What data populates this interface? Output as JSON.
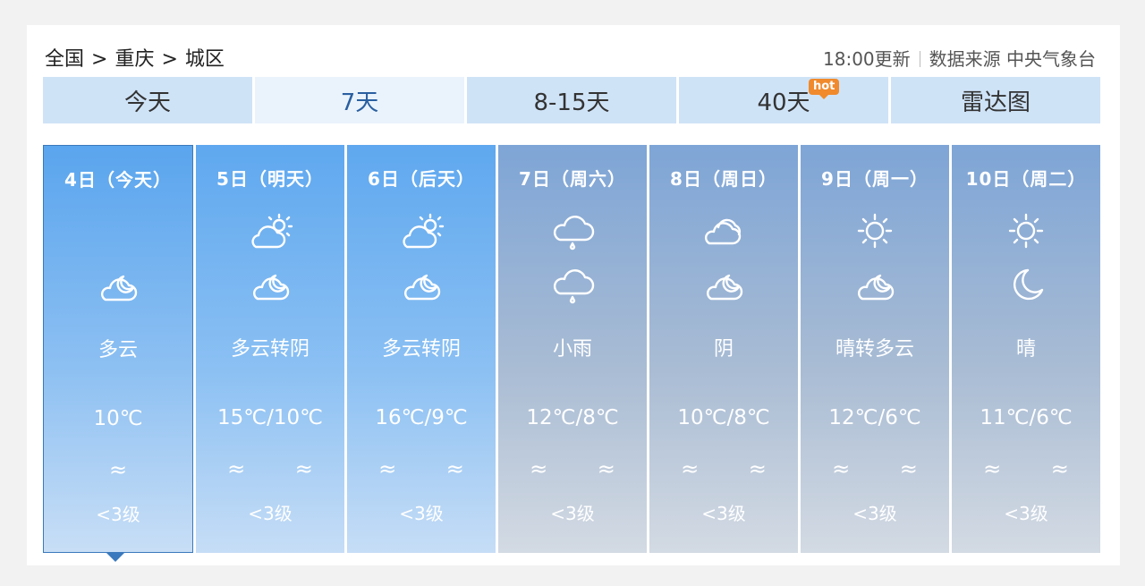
{
  "breadcrumb": {
    "items": [
      "全国",
      "重庆",
      "城区"
    ],
    "separator": ">"
  },
  "source": {
    "update_time": "18:00更新",
    "label": "数据来源 中央气象台"
  },
  "tabs": [
    {
      "label": "今天"
    },
    {
      "label": "7天",
      "active": true
    },
    {
      "label": "8-15天"
    },
    {
      "label": "40天",
      "badge": "hot"
    },
    {
      "label": "雷达图"
    }
  ],
  "days": [
    {
      "date": "4日（今天）",
      "icons": [
        "moon-cloud-icon"
      ],
      "desc": "多云",
      "temp": "10℃",
      "wind": "≈",
      "level": "<3级",
      "selected": true
    },
    {
      "date": "5日（明天）",
      "icons": [
        "sun-cloud-icon",
        "moon-cloud-icon"
      ],
      "desc": "多云转阴",
      "temp": "15℃/10℃",
      "wind": "≈ ≈",
      "level": "<3级"
    },
    {
      "date": "6日（后天）",
      "icons": [
        "sun-cloud-icon",
        "moon-cloud-icon"
      ],
      "desc": "多云转阴",
      "temp": "16℃/9℃",
      "wind": "≈ ≈",
      "level": "<3级"
    },
    {
      "date": "7日（周六）",
      "icons": [
        "rain-cloud-icon",
        "rain-cloud-icon"
      ],
      "desc": "小雨",
      "temp": "12℃/8℃",
      "wind": "≈ ≈",
      "level": "<3级"
    },
    {
      "date": "8日（周日）",
      "icons": [
        "overcast-cloud-icon",
        "moon-cloud-icon"
      ],
      "desc": "阴",
      "temp": "10℃/8℃",
      "wind": "≈ ≈",
      "level": "<3级"
    },
    {
      "date": "9日（周一）",
      "icons": [
        "sun-icon",
        "moon-cloud-icon"
      ],
      "desc": "晴转多云",
      "temp": "12℃/6℃",
      "wind": "≈ ≈",
      "level": "<3级"
    },
    {
      "date": "10日（周二）",
      "icons": [
        "sun-icon",
        "moon-icon"
      ],
      "desc": "晴",
      "temp": "11℃/6℃",
      "wind": "≈ ≈",
      "level": "<3级"
    }
  ]
}
